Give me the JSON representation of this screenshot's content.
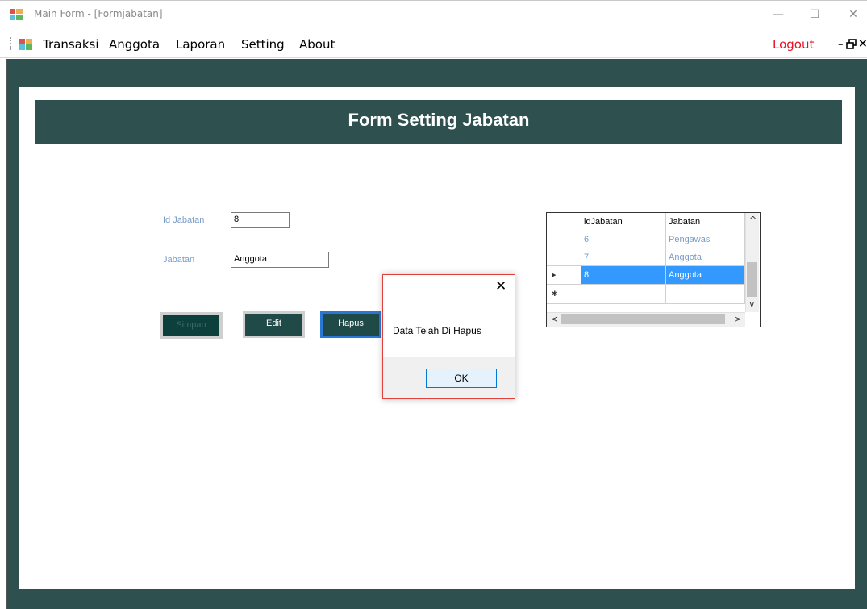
{
  "window": {
    "title": "Main Form - [Formjabatan]",
    "minimize_glyph": "—",
    "maximize_glyph": "☐",
    "close_glyph": "✕"
  },
  "menu": {
    "items": [
      "Transaksi",
      "Anggota",
      "Laporan",
      "Setting",
      "About"
    ],
    "logout": "Logout",
    "mdi_minimize_glyph": "–",
    "mdi_close_glyph": "×"
  },
  "form": {
    "title": "Form Setting Jabatan",
    "id_jabatan_label": "Id Jabatan",
    "id_jabatan_value": "8",
    "jabatan_label": "Jabatan",
    "jabatan_value": "Anggota",
    "buttons": {
      "simpan": "Simpan",
      "edit": "Edit",
      "hapus": "Hapus"
    }
  },
  "grid": {
    "columns": [
      "idJabatan",
      "Jabatan"
    ],
    "rows": [
      {
        "idJabatan": "6",
        "Jabatan": "Pengawas"
      },
      {
        "idJabatan": "7",
        "Jabatan": "Anggota"
      },
      {
        "idJabatan": "8",
        "Jabatan": "Anggota"
      }
    ],
    "selected_row_index": 2,
    "current_row_marker": "▸",
    "new_row_marker": "✱",
    "scroll_up": "^",
    "scroll_down": "v",
    "scroll_left": "<",
    "scroll_right": ">"
  },
  "dialog": {
    "message": "Data Telah Di Hapus",
    "ok_label": "OK",
    "close_glyph": "✕"
  },
  "colors": {
    "workspace": "#2e514f",
    "logout": "#e81123",
    "selection": "#3399ff"
  }
}
